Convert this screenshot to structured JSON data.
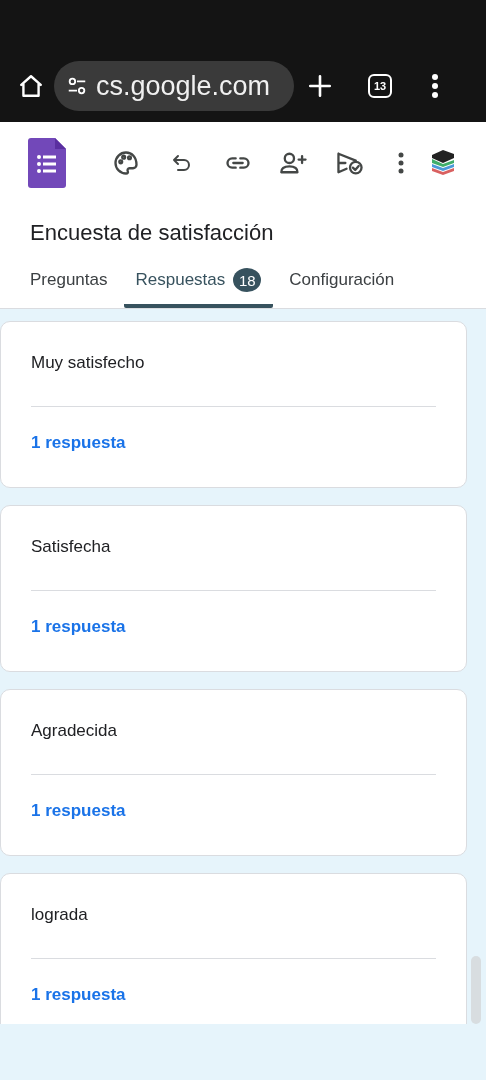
{
  "browser": {
    "url": "cs.google.com",
    "tab_count": "13"
  },
  "form": {
    "title": "Encuesta de satisfacción"
  },
  "tabs": [
    {
      "label": "Preguntas",
      "selected": false
    },
    {
      "label": "Respuestas",
      "selected": true,
      "badge": "18"
    },
    {
      "label": "Configuración",
      "selected": false
    }
  ],
  "answers": [
    {
      "text": "Muy satisfecho",
      "count": "1 respuesta"
    },
    {
      "text": "Satisfecha",
      "count": "1 respuesta"
    },
    {
      "text": "Agradecida",
      "count": "1 respuesta"
    },
    {
      "text": "lograda",
      "count": "1 respuesta"
    }
  ]
}
